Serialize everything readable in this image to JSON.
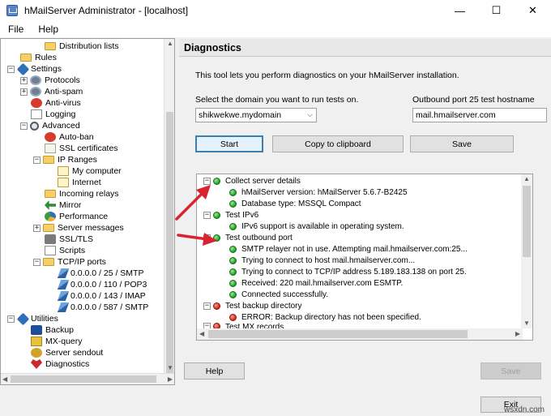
{
  "window": {
    "title": "hMailServer Administrator - [localhost]",
    "minimize_glyph": "—",
    "maximize_glyph": "☐",
    "close_glyph": "✕"
  },
  "menu": [
    "File",
    "Help"
  ],
  "tree": {
    "items": [
      {
        "label": "Distribution lists",
        "icon": "folder-icon"
      },
      {
        "label": "Rules",
        "icon": "folder-icon"
      },
      {
        "label": "Settings",
        "icon": "tools-icon"
      },
      {
        "label": "Protocols",
        "icon": "gear-icon"
      },
      {
        "label": "Anti-spam",
        "icon": "gear-icon"
      },
      {
        "label": "Anti-virus",
        "icon": "virus-icon"
      },
      {
        "label": "Logging",
        "icon": "document-icon"
      },
      {
        "label": "Advanced",
        "icon": "magnifier-icon"
      },
      {
        "label": "Auto-ban",
        "icon": "red-circle-icon"
      },
      {
        "label": "SSL certificates",
        "icon": "certificate-icon"
      },
      {
        "label": "IP Ranges",
        "icon": "folder-icon"
      },
      {
        "label": "My computer",
        "icon": "computer-icon"
      },
      {
        "label": "Internet",
        "icon": "computer-icon"
      },
      {
        "label": "Incoming relays",
        "icon": "folder-icon"
      },
      {
        "label": "Mirror",
        "icon": "mirror-icon"
      },
      {
        "label": "Performance",
        "icon": "performance-icon"
      },
      {
        "label": "Server messages",
        "icon": "folder-icon"
      },
      {
        "label": "SSL/TLS",
        "icon": "lock-icon"
      },
      {
        "label": "Scripts",
        "icon": "document-icon"
      },
      {
        "label": "TCP/IP ports",
        "icon": "folder-icon"
      },
      {
        "label": "0.0.0.0 / 25 / SMTP",
        "icon": "port-icon"
      },
      {
        "label": "0.0.0.0 / 110 / POP3",
        "icon": "port-icon"
      },
      {
        "label": "0.0.0.0 / 143 / IMAP",
        "icon": "port-icon"
      },
      {
        "label": "0.0.0.0 / 587 / SMTP",
        "icon": "port-icon"
      },
      {
        "label": "Utilities",
        "icon": "tools-icon"
      },
      {
        "label": "Backup",
        "icon": "backup-icon"
      },
      {
        "label": "MX-query",
        "icon": "mx-icon"
      },
      {
        "label": "Server sendout",
        "icon": "sendout-icon"
      },
      {
        "label": "Diagnostics",
        "icon": "heart-icon"
      }
    ]
  },
  "panel": {
    "header": "Diagnostics",
    "intro": "This tool lets you perform diagnostics on your hMailServer installation.",
    "domain_label": "Select the domain you want to run tests on.",
    "domain_value": "shikwekwe.mydomain",
    "hostname_label": "Outbound port 25 test hostname",
    "hostname_value": "mail.hmailserver.com",
    "start_button": "Start",
    "copy_button": "Copy to clipboard",
    "save_button": "Save"
  },
  "results": {
    "rows": [
      {
        "text": "Collect server details",
        "status": "green",
        "level": 0
      },
      {
        "text": "hMailServer version: hMailServer 5.6.7-B2425",
        "status": "green",
        "level": 1
      },
      {
        "text": "Database type: MSSQL Compact",
        "status": "green",
        "level": 1
      },
      {
        "text": "Test IPv6",
        "status": "green",
        "level": 0
      },
      {
        "text": "IPv6 support is available in operating system.",
        "status": "green",
        "level": 1
      },
      {
        "text": "Test outbound port",
        "status": "green",
        "level": 0
      },
      {
        "text": "SMTP relayer not in use. Attempting mail.hmailserver.com:25...",
        "status": "green",
        "level": 1
      },
      {
        "text": "Trying to connect to host mail.hmailserver.com...",
        "status": "green",
        "level": 1
      },
      {
        "text": "Trying to connect to TCP/IP address 5.189.183.138 on port 25.",
        "status": "green",
        "level": 1
      },
      {
        "text": "Received: 220 mail.hmailserver.com ESMTP.",
        "status": "green",
        "level": 1
      },
      {
        "text": "Connected successfully.",
        "status": "green",
        "level": 1
      },
      {
        "text": "Test backup directory",
        "status": "red",
        "level": 0
      },
      {
        "text": "ERROR: Backup directory has not been specified.",
        "status": "red",
        "level": 1
      },
      {
        "text": "Test MX records",
        "status": "red",
        "level": 0
      }
    ]
  },
  "footer": {
    "help_button": "Help",
    "save_button": "Save",
    "exit_button": "Exit"
  },
  "watermark": "wsxdn.com",
  "colors": {
    "status_ok": "#1f9a22",
    "status_error": "#cc2617",
    "annotation_arrow": "#d9232e",
    "focus_border": "#3c7fb1"
  }
}
